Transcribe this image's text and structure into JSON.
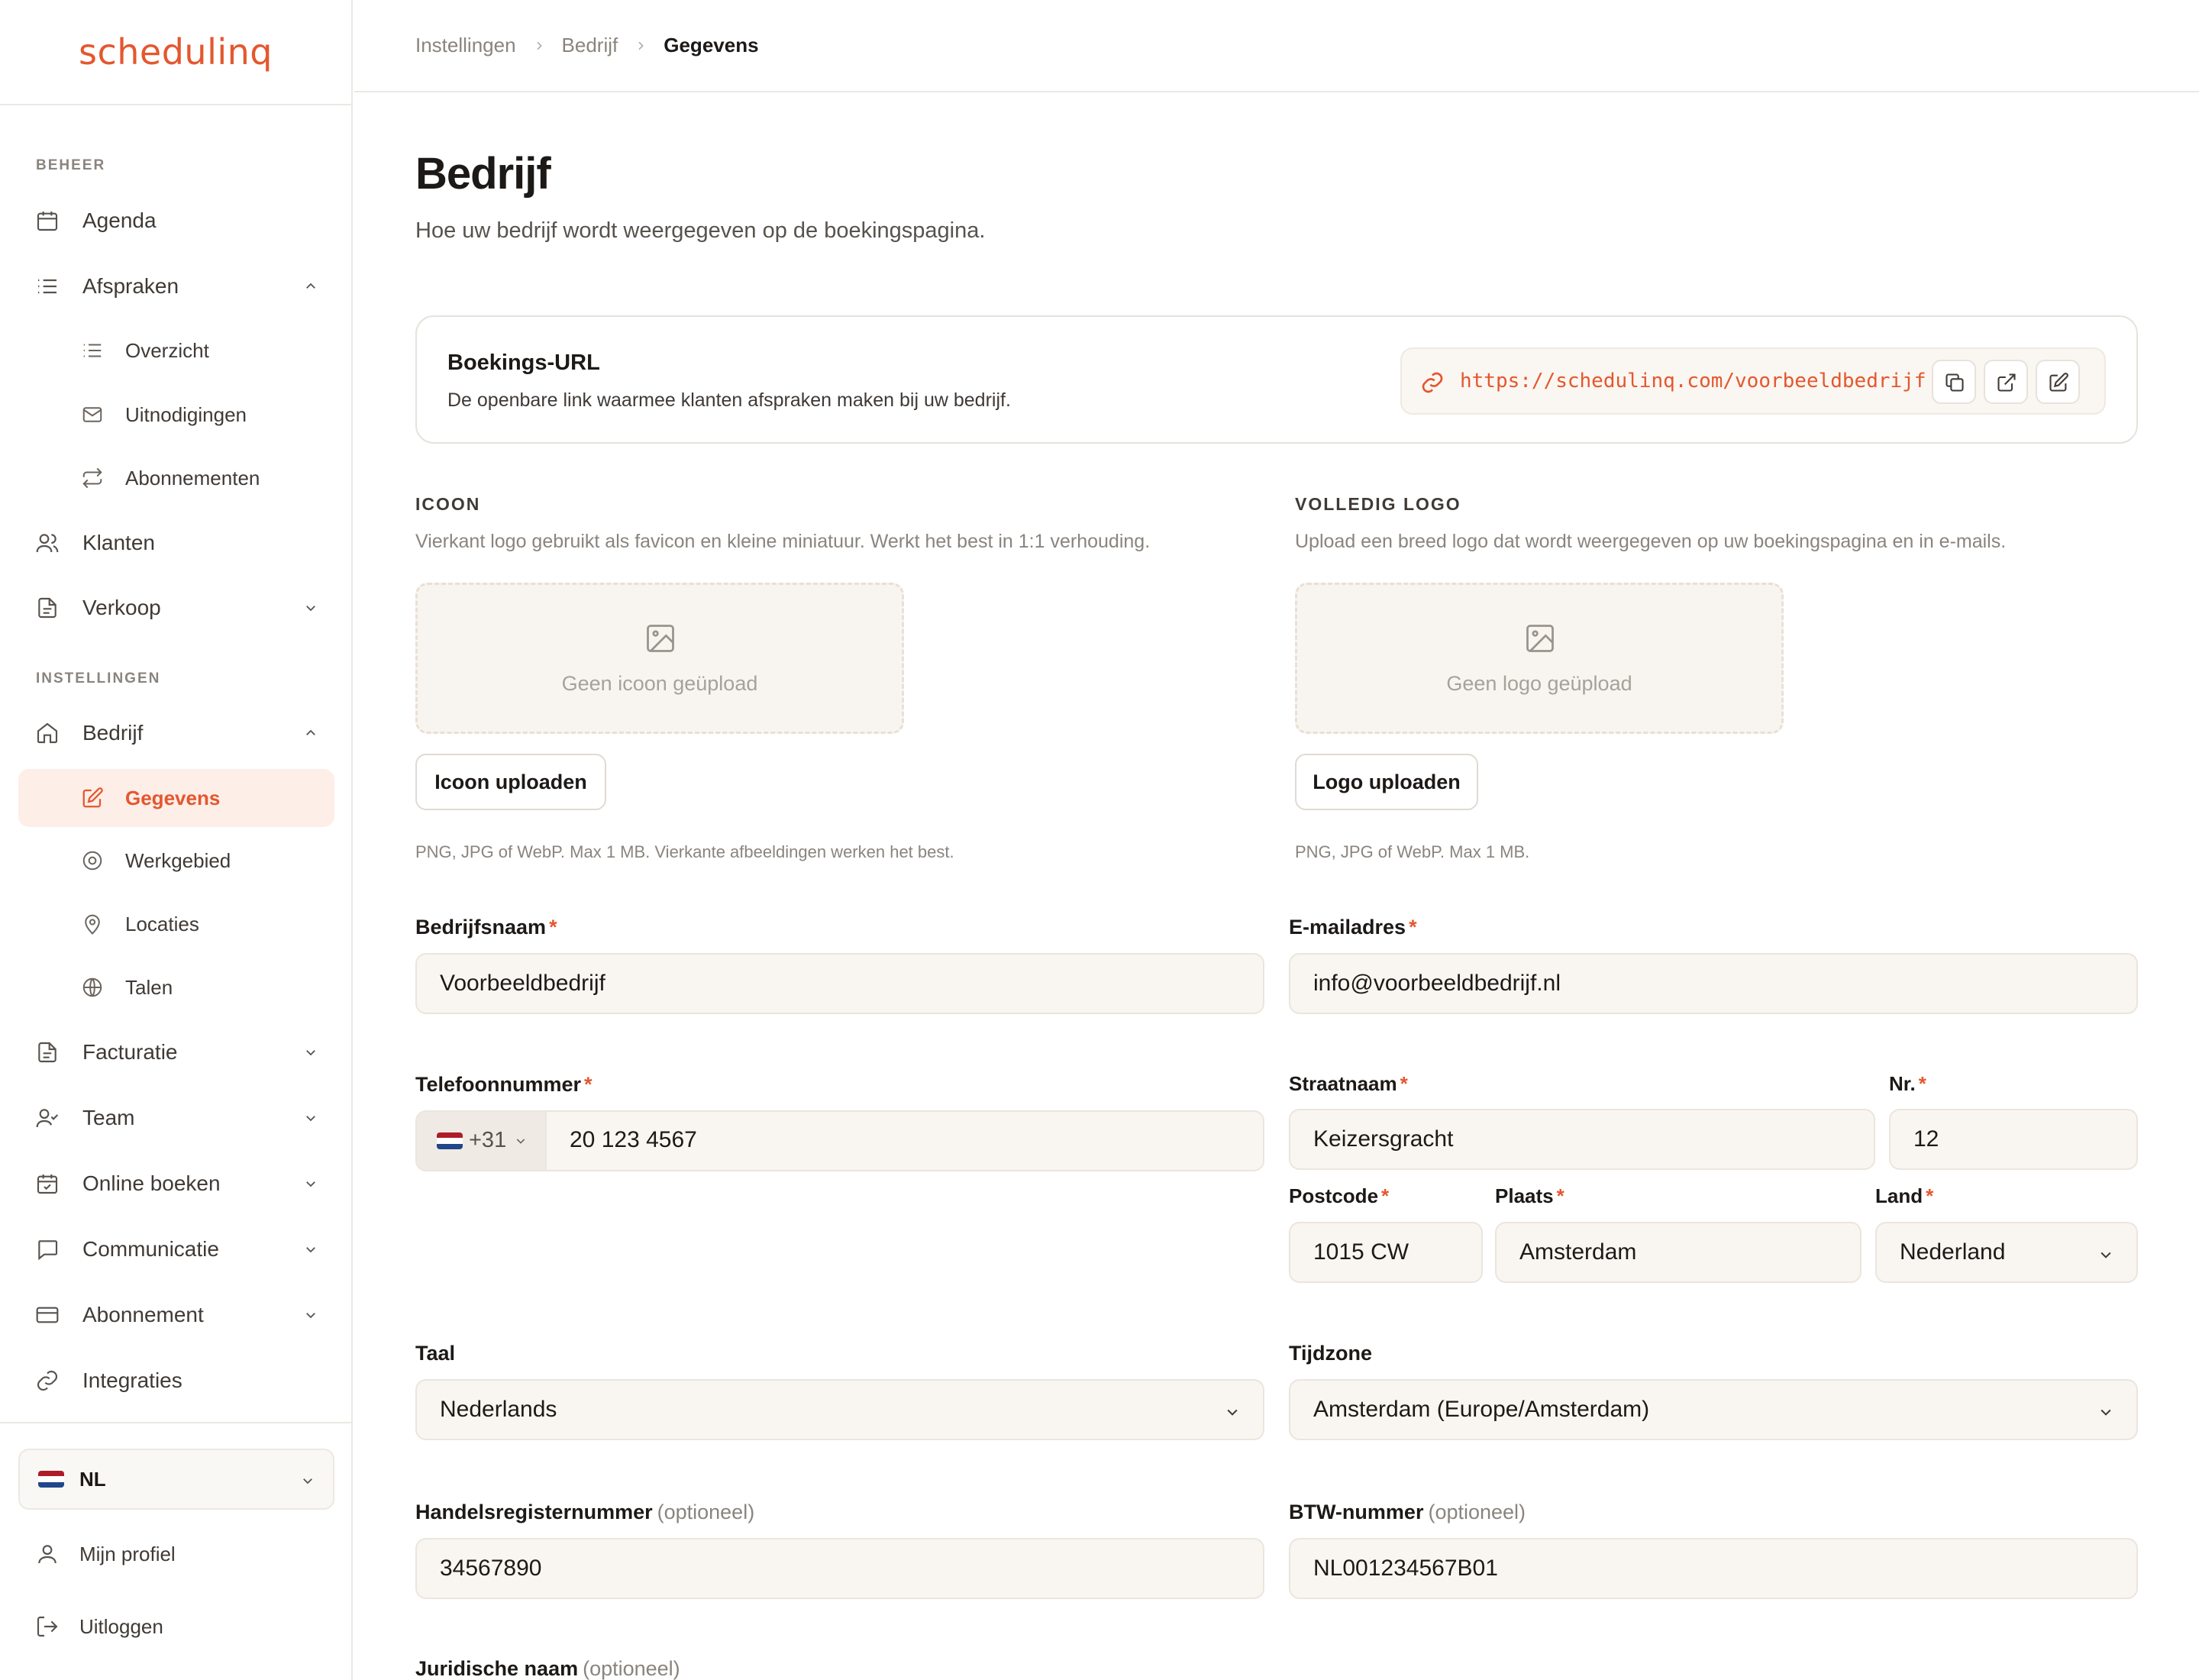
{
  "brand": {
    "logo_text": "schedulinq",
    "accent": "#e4572e"
  },
  "sidebar": {
    "section_manage": "BEHEER",
    "section_settings": "INSTELLINGEN",
    "items": {
      "agenda": "Agenda",
      "afspraken": "Afspraken",
      "overzicht": "Overzicht",
      "uitnodigingen": "Uitnodigingen",
      "abonnementen": "Abonnementen",
      "klanten": "Klanten",
      "verkoop": "Verkoop",
      "bedrijf": "Bedrijf",
      "gegevens": "Gegevens",
      "werkgebied": "Werkgebied",
      "locaties": "Locaties",
      "talen": "Talen",
      "facturatie": "Facturatie",
      "team": "Team",
      "online_boeken": "Online boeken",
      "communicatie": "Communicatie",
      "abonnement": "Abonnement",
      "integraties": "Integraties"
    },
    "language": "NL",
    "profile": "Mijn profiel",
    "logout": "Uitloggen"
  },
  "breadcrumb": [
    "Instellingen",
    "Bedrijf",
    "Gegevens"
  ],
  "page": {
    "title": "Bedrijf",
    "subtitle": "Hoe uw bedrijf wordt weergegeven op de boekingspagina."
  },
  "booking_url": {
    "title": "Boekings-URL",
    "description": "De openbare link waarmee klanten afspraken maken bij uw bedrijf.",
    "url": "https://schedulinq.com/voorbeeldbedrijf"
  },
  "icon_upload": {
    "title": "ICOON",
    "description": "Vierkant logo gebruikt als favicon en kleine miniatuur. Werkt het best in 1:1 verhouding.",
    "empty": "Geen icoon geüpload",
    "button": "Icoon uploaden",
    "hint": "PNG, JPG of WebP. Max 1 MB. Vierkante afbeeldingen werken het best."
  },
  "logo_upload": {
    "title": "VOLLEDIG LOGO",
    "description": "Upload een breed logo dat wordt weergegeven op uw boekingspagina en in e-mails.",
    "empty": "Geen logo geüpload",
    "button": "Logo uploaden",
    "hint": "PNG, JPG of WebP. Max 1 MB."
  },
  "form": {
    "company_name": {
      "label": "Bedrijfsnaam",
      "value": "Voorbeeldbedrijf"
    },
    "email": {
      "label": "E-mailadres",
      "value": "info@voorbeeldbedrijf.nl"
    },
    "phone": {
      "label": "Telefoonnummer",
      "prefix": "+31",
      "value": "20 123 4567"
    },
    "street": {
      "label": "Straatnaam",
      "value": "Keizersgracht"
    },
    "number": {
      "label": "Nr.",
      "value": "12"
    },
    "postcode": {
      "label": "Postcode",
      "value": "1015 CW"
    },
    "city": {
      "label": "Plaats",
      "value": "Amsterdam"
    },
    "country": {
      "label": "Land",
      "value": "Nederland"
    },
    "language": {
      "label": "Taal",
      "value": "Nederlands"
    },
    "timezone": {
      "label": "Tijdzone",
      "value": "Amsterdam (Europe/Amsterdam)"
    },
    "kvk": {
      "label": "Handelsregisternummer",
      "optional": "(optioneel)",
      "value": "34567890"
    },
    "vat": {
      "label": "BTW-nummer",
      "optional": "(optioneel)",
      "value": "NL001234567B01"
    },
    "legal_name": {
      "label": "Juridische naam",
      "optional": "(optioneel)"
    },
    "required_mark": "*"
  }
}
